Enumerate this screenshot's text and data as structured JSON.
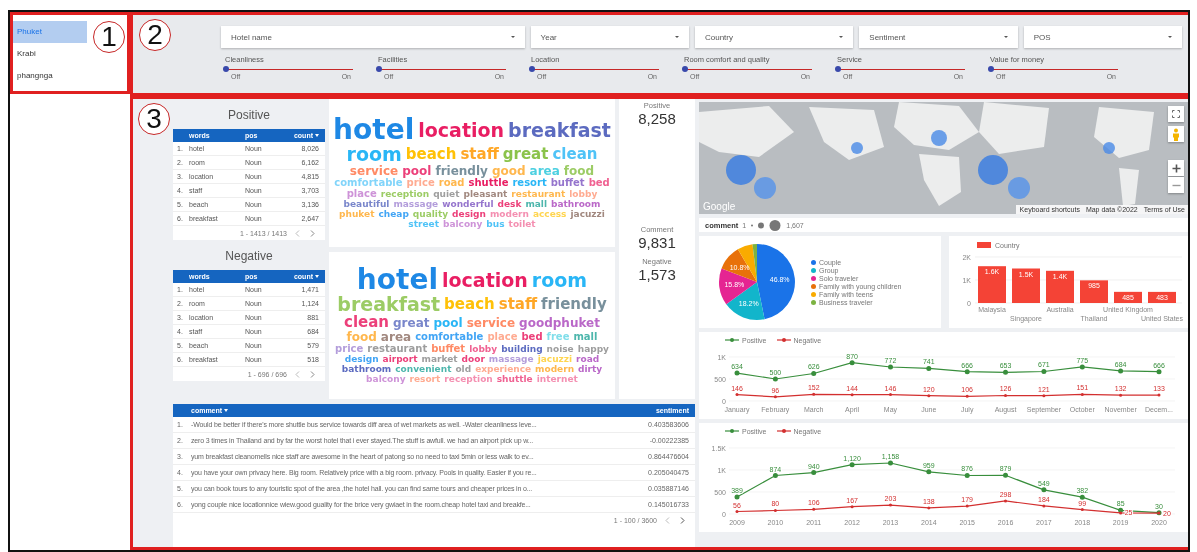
{
  "callouts": [
    "1",
    "2",
    "3"
  ],
  "sidebar": {
    "items": [
      {
        "label": "Phuket",
        "selected": true
      },
      {
        "label": "Krabi",
        "selected": false
      },
      {
        "label": "phangnga",
        "selected": false
      }
    ]
  },
  "filters": {
    "dropdowns": [
      {
        "label": "Hotel name"
      },
      {
        "label": "Year"
      },
      {
        "label": "Country"
      },
      {
        "label": "Sentiment"
      },
      {
        "label": "POS"
      }
    ],
    "toggles": [
      {
        "label": "Cleanliness",
        "level": 0,
        "off": "Off",
        "on": "On"
      },
      {
        "label": "Facilities",
        "level": 0,
        "off": "Off",
        "on": "On"
      },
      {
        "label": "Location",
        "level": 0,
        "off": "Off",
        "on": "On"
      },
      {
        "label": "Room comfort and quality",
        "level": 0,
        "off": "Off",
        "on": "On"
      },
      {
        "label": "Service",
        "level": 0,
        "off": "Off",
        "on": "On"
      },
      {
        "label": "Value for money",
        "level": 0,
        "off": "Off",
        "on": "On"
      }
    ]
  },
  "word_panels": [
    {
      "title": "Positive",
      "columns": [
        {
          "label": "words",
          "sorted": false
        },
        {
          "label": "pos",
          "sorted": false
        },
        {
          "label": "count",
          "sorted": true
        }
      ],
      "rows": [
        {
          "index": "1.",
          "word": "hotel",
          "pos": "Noun",
          "count": "8,026"
        },
        {
          "index": "2.",
          "word": "room",
          "pos": "Noun",
          "count": "6,162"
        },
        {
          "index": "3.",
          "word": "location",
          "pos": "Noun",
          "count": "4,815"
        },
        {
          "index": "4.",
          "word": "staff",
          "pos": "Noun",
          "count": "3,703"
        },
        {
          "index": "5.",
          "word": "beach",
          "pos": "Noun",
          "count": "3,136"
        },
        {
          "index": "6.",
          "word": "breakfast",
          "pos": "Noun",
          "count": "2,647"
        }
      ],
      "pager": "1 - 1413 / 1413",
      "cloud": [
        {
          "text": "hotel",
          "color": "#1e88e5"
        },
        {
          "text": "location",
          "color": "#e91e63"
        },
        {
          "text": "breakfast",
          "color": "#5c6bc0"
        },
        {
          "text": "room",
          "color": "#29b6f6"
        },
        {
          "text": "beach",
          "color": "#ffc107"
        },
        {
          "text": "staff",
          "color": "#ffa726"
        },
        {
          "text": "great",
          "color": "#8bc34a"
        },
        {
          "text": "clean",
          "color": "#4fc3f7"
        },
        {
          "text": "service",
          "color": "#ff8a65"
        },
        {
          "text": "pool",
          "color": "#ec407a"
        },
        {
          "text": "friendly",
          "color": "#78909c"
        },
        {
          "text": "good",
          "color": "#ffb74d"
        },
        {
          "text": "area",
          "color": "#4dd0e1"
        },
        {
          "text": "food",
          "color": "#9ccc65"
        },
        {
          "text": "comfortable",
          "color": "#81d4fa"
        },
        {
          "text": "price",
          "color": "#ffab91"
        },
        {
          "text": "road",
          "color": "#ffb74d"
        },
        {
          "text": "shuttle",
          "color": "#e91e63"
        },
        {
          "text": "resort",
          "color": "#29b6f6"
        },
        {
          "text": "buffet",
          "color": "#9575cd"
        },
        {
          "text": "bed",
          "color": "#f06292"
        },
        {
          "text": "place",
          "color": "#ce93d8"
        },
        {
          "text": "reception",
          "color": "#9ccc65"
        },
        {
          "text": "quiet",
          "color": "#9e9e9e"
        },
        {
          "text": "pleasant",
          "color": "#a1887f"
        },
        {
          "text": "restaurant",
          "color": "#ffb74d"
        },
        {
          "text": "lobby",
          "color": "#ffab91"
        },
        {
          "text": "beautiful",
          "color": "#7986cb"
        },
        {
          "text": "massage",
          "color": "#b39ddb"
        },
        {
          "text": "wonderful",
          "color": "#9575cd"
        },
        {
          "text": "desk",
          "color": "#ec407a"
        },
        {
          "text": "mall",
          "color": "#4db6ac"
        },
        {
          "text": "bathroom",
          "color": "#ba68c8"
        },
        {
          "text": "phuket",
          "color": "#ffb74d"
        },
        {
          "text": "cheap",
          "color": "#42a5f5"
        },
        {
          "text": "quality",
          "color": "#9ccc65"
        },
        {
          "text": "design",
          "color": "#ec407a"
        },
        {
          "text": "modern",
          "color": "#f48fb1"
        },
        {
          "text": "access",
          "color": "#ffd54f"
        },
        {
          "text": "jacuzzi",
          "color": "#a1887f"
        },
        {
          "text": "street",
          "color": "#4fc3f7"
        },
        {
          "text": "balcony",
          "color": "#ce93d8"
        },
        {
          "text": "bus",
          "color": "#4fc3f7"
        },
        {
          "text": "toilet",
          "color": "#f48fb1"
        }
      ]
    },
    {
      "title": "Negative",
      "columns": [
        {
          "label": "words",
          "sorted": false
        },
        {
          "label": "pos",
          "sorted": false
        },
        {
          "label": "count",
          "sorted": true
        }
      ],
      "rows": [
        {
          "index": "1.",
          "word": "hotel",
          "pos": "Noun",
          "count": "1,471"
        },
        {
          "index": "2.",
          "word": "room",
          "pos": "Noun",
          "count": "1,124"
        },
        {
          "index": "3.",
          "word": "location",
          "pos": "Noun",
          "count": "881"
        },
        {
          "index": "4.",
          "word": "staff",
          "pos": "Noun",
          "count": "684"
        },
        {
          "index": "5.",
          "word": "beach",
          "pos": "Noun",
          "count": "579"
        },
        {
          "index": "6.",
          "word": "breakfast",
          "pos": "Noun",
          "count": "518"
        }
      ],
      "pager": "1 - 696 / 696",
      "cloud": [
        {
          "text": "hotel",
          "color": "#1e88e5"
        },
        {
          "text": "location",
          "color": "#e91e63"
        },
        {
          "text": "room",
          "color": "#29b6f6"
        },
        {
          "text": "breakfast",
          "color": "#9ccc65"
        },
        {
          "text": "beach",
          "color": "#ffc107"
        },
        {
          "text": "staff",
          "color": "#ffa726"
        },
        {
          "text": "friendly",
          "color": "#78909c"
        },
        {
          "text": "clean",
          "color": "#ec407a"
        },
        {
          "text": "great",
          "color": "#7986cb"
        },
        {
          "text": "pool",
          "color": "#29b6f6"
        },
        {
          "text": "service",
          "color": "#ff8a65"
        },
        {
          "text": "goodphuket",
          "color": "#ba68c8"
        },
        {
          "text": "food",
          "color": "#ffb74d"
        },
        {
          "text": "area",
          "color": "#a1887f"
        },
        {
          "text": "comfortable",
          "color": "#42a5f5"
        },
        {
          "text": "place",
          "color": "#ffab91"
        },
        {
          "text": "bed",
          "color": "#ec407a"
        },
        {
          "text": "free",
          "color": "#80deea"
        },
        {
          "text": "mall",
          "color": "#4db6ac"
        },
        {
          "text": "price",
          "color": "#b39ddb"
        },
        {
          "text": "restaurant",
          "color": "#9e9e9e"
        },
        {
          "text": "buffet",
          "color": "#ff8a65"
        },
        {
          "text": "lobby",
          "color": "#f06292"
        },
        {
          "text": "building",
          "color": "#5c6bc0"
        },
        {
          "text": "noise",
          "color": "#9e9e9e"
        },
        {
          "text": "happy",
          "color": "#9e9e9e"
        },
        {
          "text": "design",
          "color": "#42a5f5"
        },
        {
          "text": "airport",
          "color": "#ec407a"
        },
        {
          "text": "market",
          "color": "#9e9e9e"
        },
        {
          "text": "door",
          "color": "#ec407a"
        },
        {
          "text": "massage",
          "color": "#b39ddb"
        },
        {
          "text": "jacuzzi",
          "color": "#ffd54f"
        },
        {
          "text": "road",
          "color": "#ba68c8"
        },
        {
          "text": "bathroom",
          "color": "#5c6bc0"
        },
        {
          "text": "convenient",
          "color": "#4db6ac"
        },
        {
          "text": "old",
          "color": "#9e9e9e"
        },
        {
          "text": "experience",
          "color": "#ffab91"
        },
        {
          "text": "modern",
          "color": "#ffb74d"
        },
        {
          "text": "dirty",
          "color": "#ba68c8"
        },
        {
          "text": "balcony",
          "color": "#ce93d8"
        },
        {
          "text": "resort",
          "color": "#ffab91"
        },
        {
          "text": "reception",
          "color": "#f48fb1"
        },
        {
          "text": "shuttle",
          "color": "#f06292"
        },
        {
          "text": "internet",
          "color": "#f48fb1"
        }
      ]
    }
  ],
  "totals": [
    {
      "label": "Positive",
      "value": "8,258"
    },
    {
      "label": "Comment",
      "value": "9,831"
    },
    {
      "label": "Negative",
      "value": "1,573"
    }
  ],
  "comments": {
    "columns": [
      {
        "label": "comment",
        "sorted": true
      },
      {
        "label": "sentiment",
        "sorted": false
      }
    ],
    "rows": [
      {
        "index": "1.",
        "text": "-Would be better if there's more shuttle bus service towards diff area of wet markets as well. -Water cleanliness leve...",
        "sentiment": "0.403583606"
      },
      {
        "index": "2.",
        "text": "zero 3 times in Thailand and by far the worst hotel that i ever stayed.The stuff is awfull. we had an airport pick up w...",
        "sentiment": "-0.00222385"
      },
      {
        "index": "3.",
        "text": "yum breakfast cleanomells nice staff are awesome in the heart of patong so no need to taxi 5min or less walk to ev...",
        "sentiment": "0.864476604"
      },
      {
        "index": "4.",
        "text": "you have your own privacy here. Big room. Relatively price with a big room. privacy. Pools in quality. Easier if you re...",
        "sentiment": "0.205040475"
      },
      {
        "index": "5.",
        "text": "you can book tours to any touristic spot of the area ,the hotel hall. you can find same tours and cheaper prices in o...",
        "sentiment": "0.035887146"
      },
      {
        "index": "6.",
        "text": "yong couple nice locationnice wiew.good guality for the brice very gwiaet in the room.cheap hotel taxi and breakfe...",
        "sentiment": "0.145016733"
      }
    ],
    "pager": "1 - 100 / 3600"
  },
  "map": {
    "kind": "picture",
    "logo": "Google",
    "attribution": [
      "Keyboard shortcuts",
      "Map data ©2022",
      "Terms of Use"
    ],
    "legend": {
      "label": "comment",
      "min": "1",
      "max": "1,607"
    }
  },
  "pie_panel": {
    "chart_data": {
      "type": "pie",
      "categories": [
        "Couple",
        "Group",
        "Solo traveler",
        "Family with young children",
        "Family with teens",
        "Business traveler"
      ],
      "values": [
        46.8,
        18.2,
        15.8,
        10.8,
        6.5,
        1.9
      ],
      "value_labels": [
        "46.8%",
        "18.2%",
        "15.8%",
        "10.8%",
        null,
        null
      ]
    },
    "legend": [
      {
        "color": "#1a73e8"
      },
      {
        "color": "#12b5cb"
      },
      {
        "color": "#e52592"
      },
      {
        "color": "#e8710a"
      },
      {
        "color": "#f9ab00"
      },
      {
        "color": "#7cb342"
      }
    ]
  },
  "country_chart": {
    "chart_data": {
      "type": "bar",
      "categories": [
        "Malaysia",
        "Singapore",
        "Australia",
        "Thailand",
        "United Kingdom",
        "United States"
      ],
      "series": [
        {
          "name": "Country",
          "color": "#f44336",
          "values": [
            1600,
            1500,
            1400,
            985,
            485,
            483
          ]
        }
      ],
      "ylim": [
        0,
        2000
      ],
      "yticks": [
        0,
        {
          "value": 1000,
          "label": "1K"
        },
        {
          "value": 2000,
          "label": "2K"
        }
      ],
      "value_labels": [
        "1.6K",
        "1.5K",
        "1.4K",
        "985",
        "485",
        "483"
      ]
    }
  },
  "month_chart": {
    "chart_data": {
      "type": "line",
      "categories": [
        "January",
        "February",
        "March",
        "April",
        "May",
        "June",
        "July",
        "August",
        "September",
        "October",
        "November",
        "Decem..."
      ],
      "series": [
        {
          "name": "Positive",
          "color": "#388e3c",
          "values": [
            634,
            500,
            626,
            870,
            772,
            741,
            666,
            653,
            671,
            775,
            684,
            666
          ]
        },
        {
          "name": "Negative",
          "color": "#d32f2f",
          "values": [
            146,
            96,
            152,
            144,
            146,
            120,
            106,
            126,
            121,
            151,
            132,
            133
          ]
        }
      ],
      "ylim": [
        0,
        1000
      ],
      "yticks": [
        0,
        500,
        {
          "value": 1000,
          "label": "1K"
        }
      ],
      "value_labels": [
        [
          "634",
          "500",
          "626",
          "870",
          "772",
          "741",
          "666",
          "653",
          "671",
          "775",
          "684",
          "666"
        ],
        [
          "146",
          "96",
          "152",
          "144",
          "146",
          "120",
          "106",
          "126",
          "121",
          "151",
          "132",
          "133"
        ]
      ]
    }
  },
  "year_chart": {
    "chart_data": {
      "type": "line",
      "categories": [
        "2009",
        "2010",
        "2011",
        "2012",
        "2013",
        "2014",
        "2015",
        "2016",
        "2017",
        "2018",
        "2019",
        "2020"
      ],
      "series": [
        {
          "name": "Positive",
          "color": "#388e3c",
          "values": [
            389,
            874,
            940,
            1120,
            1158,
            959,
            876,
            879,
            549,
            382,
            85,
            30
          ]
        },
        {
          "name": "Negative",
          "color": "#d32f2f",
          "values": [
            56,
            80,
            106,
            167,
            203,
            138,
            179,
            298,
            184,
            99,
            25,
            20
          ]
        }
      ],
      "ylim": [
        0,
        1500
      ],
      "yticks": [
        0,
        500,
        {
          "value": 1000,
          "label": "1K"
        },
        {
          "value": 1500,
          "label": "1.5K"
        }
      ],
      "value_labels": [
        [
          "389",
          "874",
          "940",
          "1,120",
          "1,158",
          "959",
          "876",
          "879",
          "549",
          "382",
          "85",
          "30"
        ],
        [
          "56",
          "80",
          "106",
          "167",
          "203",
          "138",
          "179",
          "298",
          "184",
          "99",
          "25",
          "20"
        ]
      ]
    }
  }
}
